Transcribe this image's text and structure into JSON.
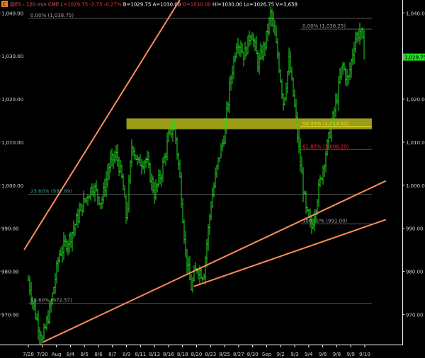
{
  "header": {
    "badge": "C",
    "parts": [
      {
        "text": "@ES - 120 min CME",
        "color": "#ff5555"
      },
      {
        "text": "L=1029.75",
        "color": "#ff3333"
      },
      {
        "text": "-2.75",
        "color": "#ff3333"
      },
      {
        "text": "-0.27%",
        "color": "#ff3333"
      },
      {
        "text": "B=1029.75",
        "color": "#ffffff"
      },
      {
        "text": "A=1030.00",
        "color": "#ffffff"
      },
      {
        "text": "O=1030.00",
        "color": "#ff3333"
      },
      {
        "text": "Hi=1030.00",
        "color": "#ffffff"
      },
      {
        "text": "Lo=1026.75",
        "color": "#ffffff"
      },
      {
        "text": "V=3,658",
        "color": "#ffffff"
      }
    ]
  },
  "colors": {
    "background": "#000000",
    "price_bars": "#22dd22",
    "trendlines": "#ff8c5a",
    "zone": "#d8d820",
    "fib_line": "#6e6e6e",
    "fib_teal": "#2e9a9a",
    "fib_red": "#ff2020",
    "axis_text": "#d0d0d0",
    "last_price_bg": "#22dd22"
  },
  "chart_data": {
    "type": "ohlc-bar",
    "title": "@ES - 120 min CME",
    "ylim": [
      963,
      1043
    ],
    "y_ticks": [
      {
        "value": 970,
        "label": "970.00"
      },
      {
        "value": 980,
        "label": "980.00"
      },
      {
        "value": 990,
        "label": "990.00"
      },
      {
        "value": 1000,
        "label": "1,000.00"
      },
      {
        "value": 1010,
        "label": "1,010.00"
      },
      {
        "value": 1020,
        "label": "1,020.00"
      },
      {
        "value": 1030,
        "label": "1,030.00"
      },
      {
        "value": 1040,
        "label": "1,040.00"
      }
    ],
    "x_ticks": [
      "7/28",
      "7/30",
      "Aug",
      "8/4",
      "8/5",
      "8/6",
      "8/7",
      "8/9",
      "8/11",
      "8/13",
      "8/16",
      "8/18",
      "8/20",
      "8/23",
      "8/25",
      "8/27",
      "8/30",
      "Sep",
      "9/2",
      "9/3",
      "9/4",
      "9/6",
      "9/8",
      "9/9",
      "9/10"
    ],
    "last_price": {
      "value": 1029.75,
      "label": "1,029.75"
    },
    "price_path": [
      {
        "x": 0.0,
        "y": 978
      },
      {
        "x": 0.5,
        "y": 970
      },
      {
        "x": 1.0,
        "y": 964
      },
      {
        "x": 1.6,
        "y": 972
      },
      {
        "x": 2.2,
        "y": 984
      },
      {
        "x": 3.0,
        "y": 988
      },
      {
        "x": 3.8,
        "y": 995
      },
      {
        "x": 4.6,
        "y": 1000
      },
      {
        "x": 5.2,
        "y": 996
      },
      {
        "x": 5.8,
        "y": 1005
      },
      {
        "x": 6.3,
        "y": 1007
      },
      {
        "x": 6.7,
        "y": 1001
      },
      {
        "x": 7.0,
        "y": 992
      },
      {
        "x": 7.4,
        "y": 1010
      },
      {
        "x": 7.8,
        "y": 1005
      },
      {
        "x": 8.4,
        "y": 1006
      },
      {
        "x": 9.0,
        "y": 998
      },
      {
        "x": 9.5,
        "y": 1003
      },
      {
        "x": 10.0,
        "y": 1011
      },
      {
        "x": 10.4,
        "y": 1014
      },
      {
        "x": 10.8,
        "y": 1002
      },
      {
        "x": 11.2,
        "y": 985
      },
      {
        "x": 11.6,
        "y": 976
      },
      {
        "x": 12.0,
        "y": 981
      },
      {
        "x": 12.5,
        "y": 979
      },
      {
        "x": 13.0,
        "y": 995
      },
      {
        "x": 13.5,
        "y": 1005
      },
      {
        "x": 14.0,
        "y": 1012
      },
      {
        "x": 14.4,
        "y": 1024
      },
      {
        "x": 14.9,
        "y": 1034
      },
      {
        "x": 15.4,
        "y": 1030
      },
      {
        "x": 15.9,
        "y": 1036
      },
      {
        "x": 16.4,
        "y": 1028
      },
      {
        "x": 16.9,
        "y": 1033
      },
      {
        "x": 17.3,
        "y": 1040
      },
      {
        "x": 17.8,
        "y": 1030
      },
      {
        "x": 18.2,
        "y": 1019
      },
      {
        "x": 18.6,
        "y": 1029
      },
      {
        "x": 19.0,
        "y": 1018
      },
      {
        "x": 19.4,
        "y": 1005
      },
      {
        "x": 19.8,
        "y": 994
      },
      {
        "x": 20.2,
        "y": 990
      },
      {
        "x": 20.6,
        "y": 997
      },
      {
        "x": 21.0,
        "y": 1004
      },
      {
        "x": 21.5,
        "y": 1012
      },
      {
        "x": 22.0,
        "y": 1020
      },
      {
        "x": 22.4,
        "y": 1028
      },
      {
        "x": 22.8,
        "y": 1024
      },
      {
        "x": 23.3,
        "y": 1034
      },
      {
        "x": 23.7,
        "y": 1036
      },
      {
        "x": 24.0,
        "y": 1029.75
      }
    ],
    "zone": {
      "low": 1013,
      "high": 1015.5,
      "x_start": 7.0,
      "x_end": 24.5
    },
    "fib_levels": [
      {
        "label": "0.00% (1,038.75)",
        "value": 1038.75,
        "x_start": 0,
        "x_end": 24.5,
        "color": "#a0a0a0"
      },
      {
        "label": "0.00% (1,036.25)",
        "value": 1036.25,
        "x_start": 19.4,
        "x_end": 24.5,
        "color": "#a0a0a0"
      },
      {
        "label": "50.00% (1,013.63)",
        "value": 1013.63,
        "x_start": 19.4,
        "x_end": 24.5,
        "color": "#f0f060"
      },
      {
        "label": "61.80% (1,008.29)",
        "value": 1008.29,
        "x_start": 19.4,
        "x_end": 24.5,
        "color": "#ff2020"
      },
      {
        "label": "23.60% (997.89)",
        "value": 997.89,
        "x_start": 0,
        "x_end": 24.5,
        "color": "#2e9a9a"
      },
      {
        "label": "100.00% (991.00)",
        "value": 991.0,
        "x_start": 19.4,
        "x_end": 24.5,
        "color": "#a0a0a0"
      },
      {
        "label": "78.60% (972.57)",
        "value": 972.57,
        "x_start": 0,
        "x_end": 24.5,
        "color": "#a0a0a0"
      }
    ],
    "trendlines": [
      {
        "x1": -0.3,
        "y1": 985,
        "x2": 10.8,
        "y2": 1043
      },
      {
        "x1": 1.0,
        "y1": 963.5,
        "x2": 25.5,
        "y2": 1001
      },
      {
        "x1": 11.8,
        "y1": 976.5,
        "x2": 25.5,
        "y2": 992
      }
    ]
  }
}
